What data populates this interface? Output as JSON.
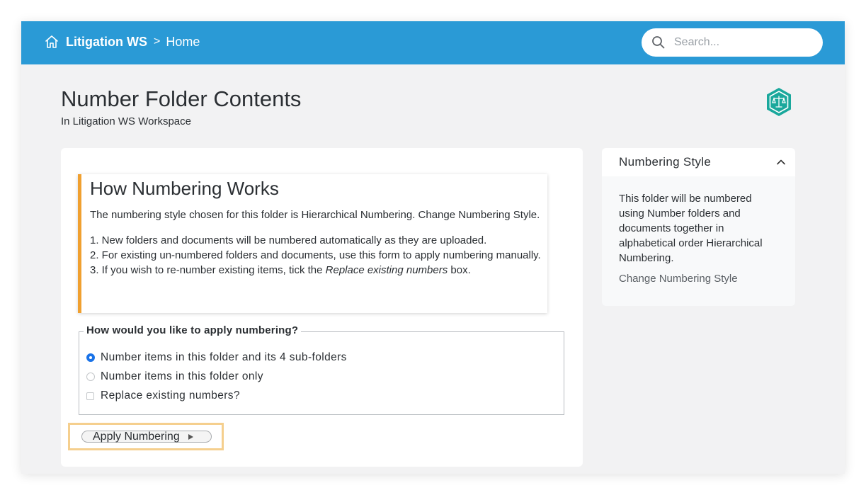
{
  "header": {
    "workspace": "Litigation WS",
    "separator": ">",
    "current": "Home",
    "search_placeholder": "Search..."
  },
  "page": {
    "title": "Number Folder Contents",
    "subtitle": "In Litigation WS Workspace"
  },
  "info": {
    "heading": "How Numbering Works",
    "intro": "The numbering style chosen for this folder is Hierarchical Numbering. Change Numbering Style.",
    "step1": "1. New folders and documents will be numbered automatically as they are uploaded.",
    "step2": "2. For existing un-numbered folders and documents, use this form to apply numbering manually.",
    "step3_before": "3. If you wish to re-number existing items, tick the ",
    "step3_em": "Replace existing numbers",
    "step3_after": " box."
  },
  "form": {
    "legend": "How would you like to apply numbering?",
    "options": [
      {
        "label": "Number items in this folder and its 4 sub-folders",
        "selected": true
      },
      {
        "label": "Number items in this folder only",
        "selected": false
      }
    ],
    "replace_label": "Replace existing numbers?",
    "replace_checked": false,
    "apply_label": "Apply Numbering"
  },
  "sidebar": {
    "title": "Numbering Style",
    "description": "This folder will be numbered using Number folders and documents together in alphabetical order Hierarchical Numbering.",
    "link": "Change Numbering Style"
  },
  "colors": {
    "topbar": "#2a9ad6",
    "accent_border": "#f0a030",
    "highlight": "#f5cf8e",
    "radio_selected": "#1a73e8",
    "badge": "#1aa89c"
  },
  "icons": {
    "home": "home-icon",
    "search": "search-icon",
    "badge": "scales-badge-icon",
    "collapse": "chevron-up-icon",
    "apply": "play-icon"
  }
}
